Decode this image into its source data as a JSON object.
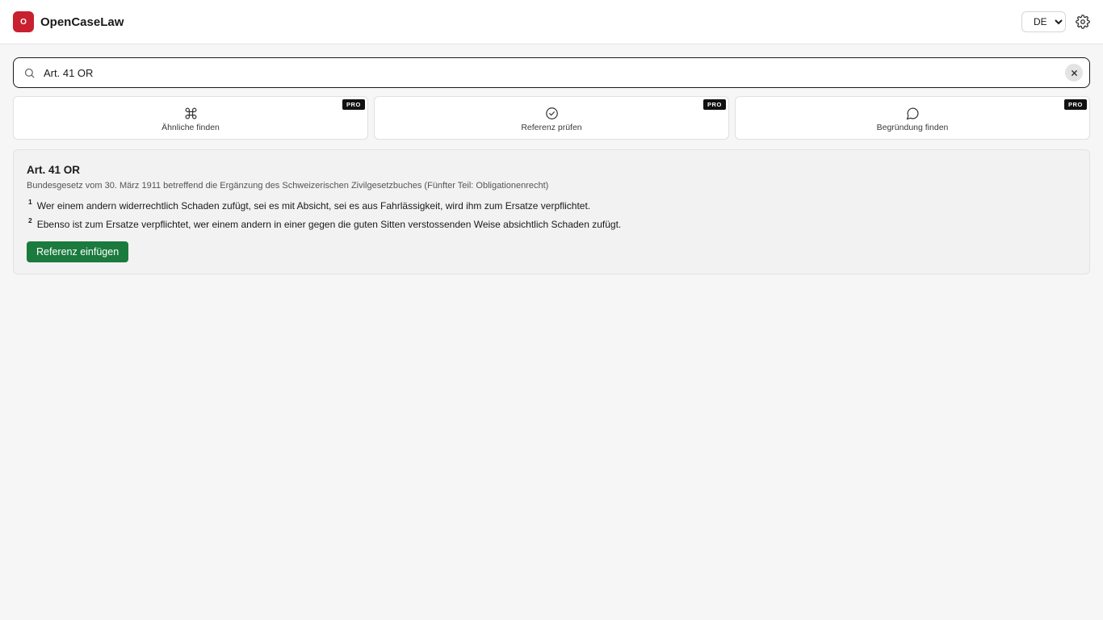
{
  "header": {
    "logo_letter": "O",
    "brand_name": "OpenCaseLaw",
    "language": {
      "selected": "DE",
      "options": [
        "DE"
      ]
    }
  },
  "search": {
    "value": "Art. 41 OR",
    "placeholder": ""
  },
  "actions": [
    {
      "label": "Ähnliche finden",
      "badge": "PRO",
      "icon": "command-icon"
    },
    {
      "label": "Referenz prüfen",
      "badge": "PRO",
      "icon": "check-circle-icon"
    },
    {
      "label": "Begründung finden",
      "badge": "PRO",
      "icon": "speech-bubble-icon"
    }
  ],
  "result": {
    "title": "Art. 41 OR",
    "subtitle": "Bundesgesetz vom 30. März 1911 betreffend die Ergänzung des Schweizerischen Zivilgesetzbuches (Fünfter Teil: Obligationenrecht)",
    "paragraphs": [
      {
        "num": "1",
        "text": "Wer einem andern widerrechtlich Schaden zufügt, sei es mit Absicht, sei es aus Fahrlässigkeit, wird ihm zum Ersatze verpflichtet."
      },
      {
        "num": "2",
        "text": "Ebenso ist zum Ersatze verpflichtet, wer einem andern in einer gegen die guten Sitten verstossenden Weise absichtlich Schaden zufügt."
      }
    ],
    "insert_label": "Referenz einfügen"
  },
  "colors": {
    "brand": "#c8202f",
    "primary_button": "#1b7a3d",
    "badge": "#111111"
  }
}
